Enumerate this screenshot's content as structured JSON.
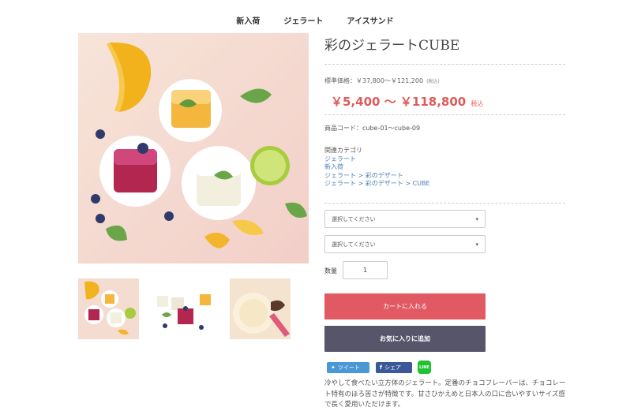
{
  "nav": {
    "items": [
      "新入荷",
      "ジェラート",
      "アイスサンド"
    ]
  },
  "product": {
    "title": "彩のジェラートCUBE",
    "msrp_label": "標準価格：￥37,800～￥121,200",
    "msrp_tax": "(税込)",
    "price": "￥5,400 ～ ￥118,800",
    "price_tax": "税込",
    "code": "商品コード：cube-01～cube-09"
  },
  "categories": {
    "heading": "関連カテゴリ",
    "links": [
      "ジェラート",
      "新入荷",
      "ジェラート > 彩のデザート",
      "ジェラート > 彩のデザート > CUBE"
    ]
  },
  "options": {
    "select1": "選択してください",
    "select2": "選択してください"
  },
  "quantity": {
    "label": "数量",
    "value": "1"
  },
  "buttons": {
    "cart": "カートに入れる",
    "favorite": "お気に入りに追加"
  },
  "social": {
    "tweet": "ツイート",
    "share": "シェア",
    "line": "LINE"
  },
  "description": "冷やして食べたい立方体のジェラート。定番のチョコフレーバーは、チョコレート特有のほろ苦さが特徴です。甘さひかえめと日本人の口に合いやすいサイズ感で長く愛用いただけます。",
  "colors": {
    "price": "#e05a5a",
    "cart_button": "#e15963",
    "favorite_button": "#57556a",
    "link": "#4a7fb8",
    "twitter": "#4b98d4",
    "facebook": "#3b5998",
    "line": "#1ec232"
  }
}
